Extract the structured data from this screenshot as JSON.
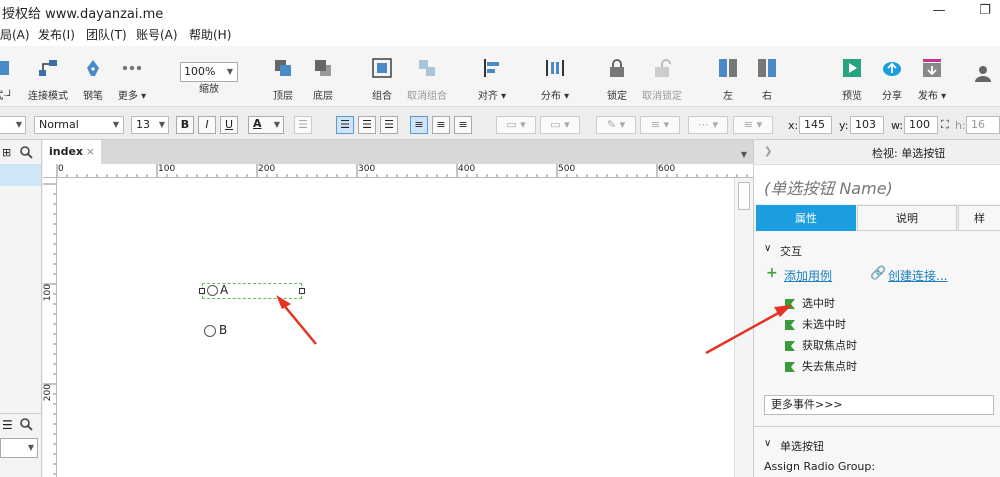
{
  "window": {
    "title": "授权给 www.dayanzai.me"
  },
  "menu": [
    "局(A)",
    "发布(I)",
    "团队(T)",
    "账号(A)",
    "帮助(H)"
  ],
  "toolbar": {
    "items": [
      {
        "label": "式·┘",
        "icon": "style-icon"
      },
      {
        "label": "连接模式",
        "icon": "connect-mode-icon"
      },
      {
        "label": "钢笔",
        "icon": "pen-icon"
      },
      {
        "label": "更多 ▾",
        "icon": "more-icon"
      },
      {
        "label": "缩放",
        "icon": "zoom-icon"
      },
      {
        "label": "顶层",
        "icon": "bring-front-icon"
      },
      {
        "label": "底层",
        "icon": "send-back-icon"
      },
      {
        "label": "组合",
        "icon": "group-icon"
      },
      {
        "label": "取消组合",
        "icon": "ungroup-icon"
      },
      {
        "label": "对齐 ▾",
        "icon": "align-icon"
      },
      {
        "label": "分布 ▾",
        "icon": "distribute-icon"
      },
      {
        "label": "锁定",
        "icon": "lock-icon"
      },
      {
        "label": "取消锁定",
        "icon": "unlock-icon"
      },
      {
        "label": "左",
        "icon": "left-panel-icon"
      },
      {
        "label": "右",
        "icon": "right-panel-icon"
      },
      {
        "label": "预览",
        "icon": "preview-icon"
      },
      {
        "label": "分享",
        "icon": "share-icon"
      },
      {
        "label": "发布 ▾",
        "icon": "publish-icon"
      }
    ],
    "zoom_value": "100%"
  },
  "format": {
    "font_style": "Normal",
    "font_size": "13",
    "bold": "B",
    "italic": "I",
    "underline": "U",
    "text_color": "A",
    "x_label": "x:",
    "x_value": "145",
    "y_label": "y:",
    "y_value": "103",
    "w_label": "w:",
    "w_value": "100",
    "h_label": "h:",
    "h_value": "16"
  },
  "document": {
    "tab": "index",
    "tab_close": "×",
    "ruler_h": [
      "0",
      "100",
      "200",
      "300",
      "400",
      "500",
      "600"
    ],
    "ruler_v": [
      "100",
      "200"
    ],
    "radio_a": "A",
    "radio_b": "B"
  },
  "inspector": {
    "header": "检视: 单选按钮",
    "name_placeholder": "(单选按钮 Name)",
    "tabs": [
      "属性",
      "说明",
      "样"
    ],
    "section_interaction": "交互",
    "add_case": "添加用例",
    "create_link": "创建连接...",
    "events": [
      "选中时",
      "未选中时",
      "获取焦点时",
      "失去焦点时"
    ],
    "more_events": "更多事件>>>",
    "section_radio": "单选按钮",
    "assign_group": "Assign Radio Group:"
  },
  "colors": {
    "accent": "#1a9ee0",
    "selection": "#5cbf5c",
    "arrow": "#e53222",
    "event_flag": "#3a9b3a"
  }
}
